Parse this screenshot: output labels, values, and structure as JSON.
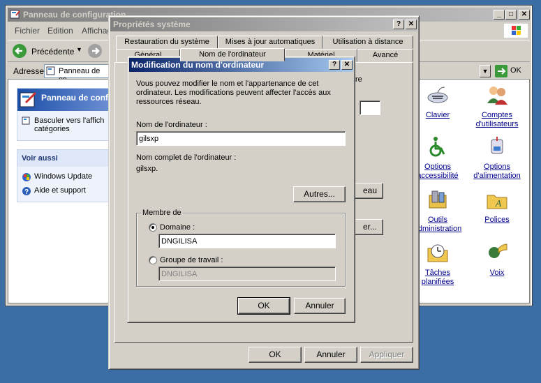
{
  "control_panel": {
    "title": "Panneau de configuration",
    "menu": [
      "Fichier",
      "Edition",
      "Affichag"
    ],
    "toolbar": {
      "back_label": "Précédente"
    },
    "address": {
      "label": "Adresse",
      "value": "Panneau de co",
      "go_label": "OK"
    },
    "left_panel": {
      "header": "Panneau de confi",
      "switch_view": "Basculer vers l'affich catégories",
      "see_also_title": "Voir aussi",
      "see_also": [
        "Windows Update",
        "Aide et support"
      ]
    },
    "icons": [
      {
        "name": "keyboard-icon",
        "label": "Clavier"
      },
      {
        "name": "user-accounts-icon",
        "label": "Comptes d'utilisateurs"
      },
      {
        "name": "accessibility-icon",
        "label": "Options accessibilité"
      },
      {
        "name": "power-options-icon",
        "label": "Options d'alimentation"
      },
      {
        "name": "admin-tools-icon",
        "label": "Outils administration"
      },
      {
        "name": "fonts-icon",
        "label": "Polices"
      },
      {
        "name": "scheduled-tasks-icon",
        "label": "Tâches planifiées"
      },
      {
        "name": "speech-icon",
        "label": "Voix"
      }
    ]
  },
  "system_properties": {
    "title": "Propriétés système",
    "tabs_row1": [
      "Restauration du système",
      "Mises à jour automatiques",
      "Utilisation à distance"
    ],
    "tabs_row2": [
      "Général",
      "Nom de l'ordinateur",
      "Matériel",
      "Avancé"
    ],
    "partial": {
      "re": "re",
      "eau": "eau",
      "er": "er..."
    },
    "buttons": {
      "ok": "OK",
      "cancel": "Annuler",
      "apply": "Appliquer"
    }
  },
  "rename_dialog": {
    "title": "Modification du nom d'ordinateur",
    "description": "Vous pouvez modifier le nom et l'appartenance de cet ordinateur. Les modifications peuvent affecter l'accès aux ressources réseau.",
    "computer_name_label": "Nom de l'ordinateur :",
    "computer_name_value": "gilsxp",
    "full_name_label": "Nom complet de l'ordinateur :",
    "full_name_value": "gilsxp.",
    "more_button": "Autres...",
    "member_of": "Membre de",
    "domain_label": "Domaine :",
    "domain_value": "DNGILISA",
    "workgroup_label": "Groupe de travail :",
    "workgroup_value": "DNGILISA",
    "ok": "OK",
    "cancel": "Annuler"
  }
}
